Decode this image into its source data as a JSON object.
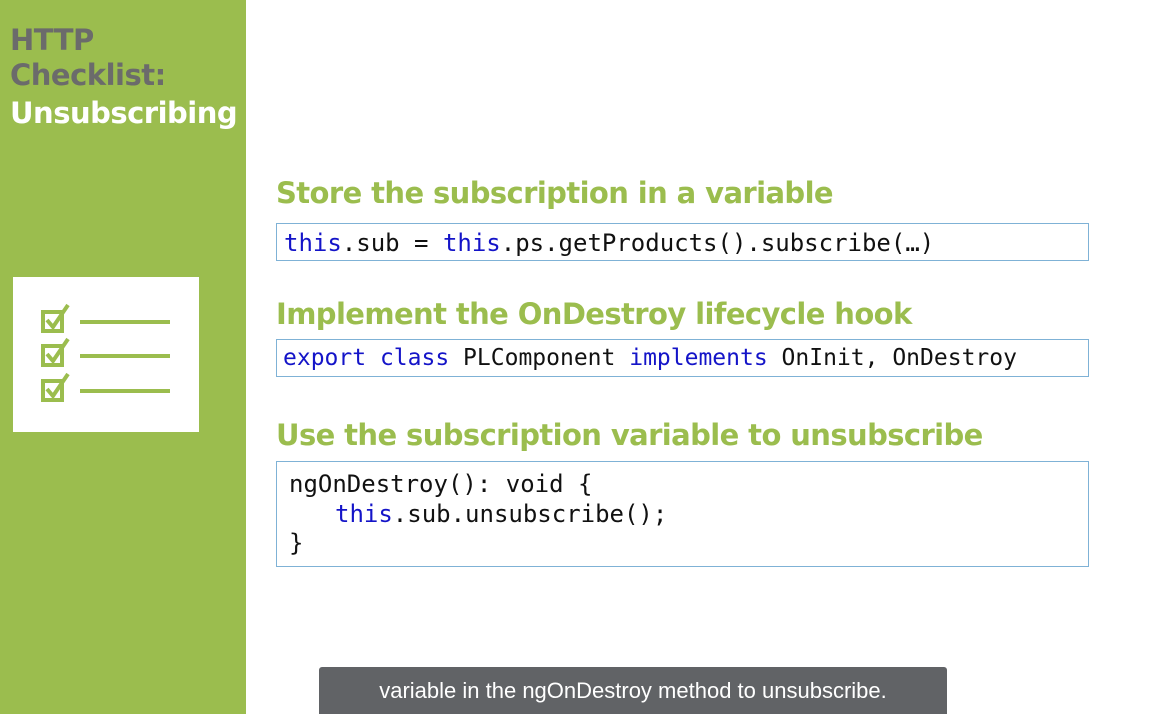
{
  "sidebar": {
    "title_line1": "HTTP",
    "title_line2": "Checklist:",
    "title_line3": "Unsubscribing",
    "icon": "checklist-icon"
  },
  "sections": [
    {
      "heading": "Store the subscription in a variable",
      "code": [
        "this",
        ".sub = ",
        "this",
        ".ps.getProducts().subscribe(…)"
      ]
    },
    {
      "heading": "Implement the OnDestroy lifecycle hook",
      "code": [
        "export",
        " ",
        "class",
        " PLComponent ",
        "implements",
        " OnInit, OnDestroy"
      ]
    },
    {
      "heading": "Use the subscription variable to unsubscribe",
      "code_line1": "ngOnDestroy(): void {",
      "code_line2_kw": "this",
      "code_line2_rest": ".sub.unsubscribe();",
      "code_line3": "}"
    }
  ],
  "caption": "variable in the ngOnDestroy method to unsubscribe.",
  "colors": {
    "accent_green": "#9bbd4e",
    "title_gray": "#6b6b6b",
    "keyword_blue": "#1414c8",
    "code_border": "#7fb2d6",
    "caption_bg": "#616366"
  }
}
